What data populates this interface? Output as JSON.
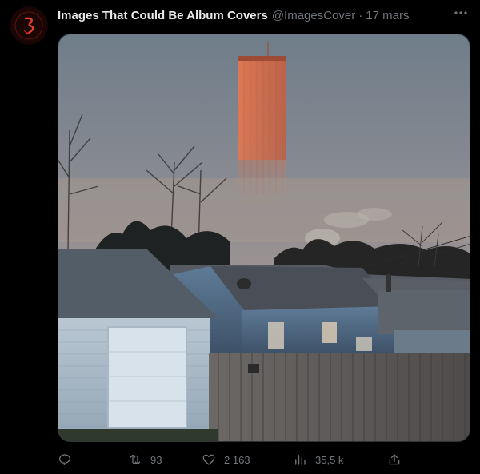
{
  "tweet": {
    "author_name": "Images That Could Be Album Covers",
    "handle": "@ImagesCover",
    "separator": "·",
    "time": "17 mars"
  },
  "actions": {
    "reply": {
      "icon": "reply-icon",
      "count": ""
    },
    "retweet": {
      "icon": "retweet-icon",
      "count": "93"
    },
    "like": {
      "icon": "heart-icon",
      "count": "2 163"
    },
    "views": {
      "icon": "views-chart-icon",
      "count": "35,5 k"
    },
    "share": {
      "icon": "share-icon",
      "count": ""
    }
  },
  "colors": {
    "background": "#000000",
    "text_primary": "#e7e9ea",
    "text_secondary": "#71767b",
    "border": "#2f3336"
  }
}
